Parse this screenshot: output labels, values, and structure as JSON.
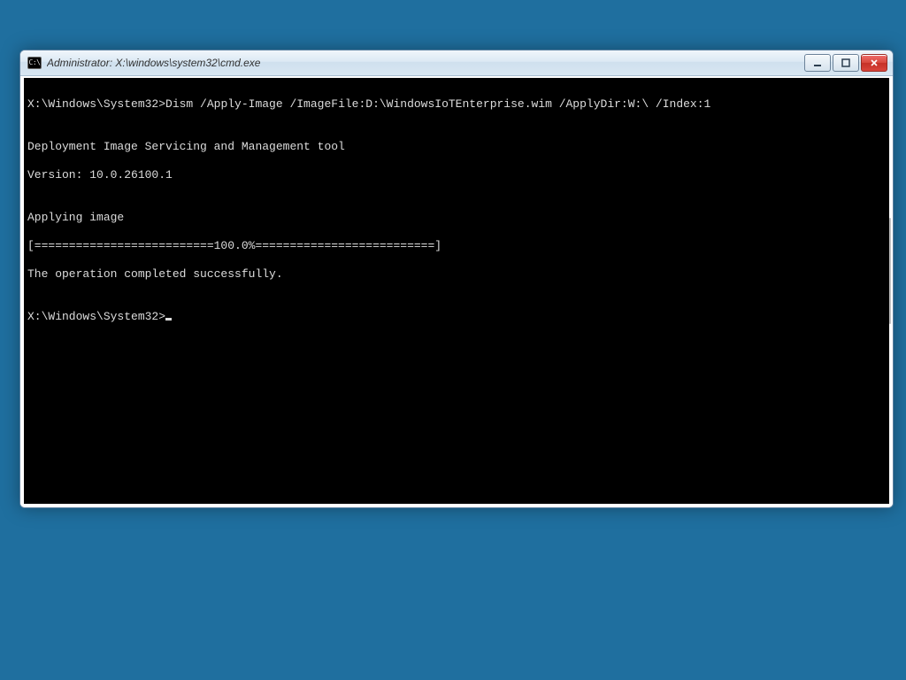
{
  "window": {
    "title": "Administrator: X:\\windows\\system32\\cmd.exe"
  },
  "terminal": {
    "prompt1": "X:\\Windows\\System32>",
    "command1": "Dism /Apply-Image /ImageFile:D:\\WindowsIoTEnterprise.wim /ApplyDir:W:\\ /Index:1",
    "blank1": "",
    "tool_line": "Deployment Image Servicing and Management tool",
    "version_line": "Version: 10.0.26100.1",
    "blank2": "",
    "applying_line": "Applying image",
    "progress_line": "[==========================100.0%==========================]",
    "success_line": "The operation completed successfully.",
    "blank3": "",
    "prompt2": "X:\\Windows\\System32>"
  }
}
